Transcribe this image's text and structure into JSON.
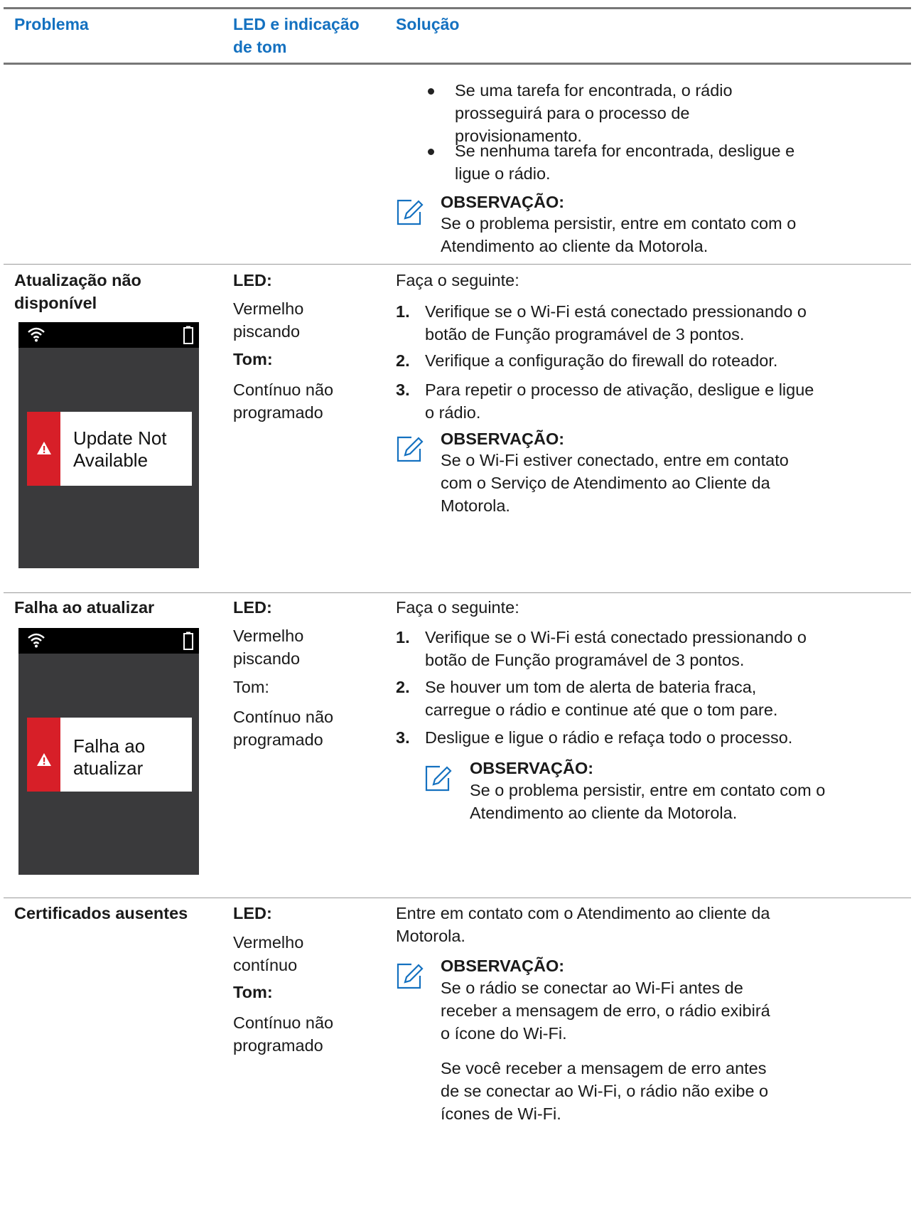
{
  "header": {
    "col_problem": "Problema",
    "col_led": "LED e indicação de tom",
    "col_solution": "Solução"
  },
  "continued_row": {
    "bullets": [
      "Se uma tarefa for encontrada, o rádio prosseguirá para o processo de provisionamento.",
      "Se nenhuma tarefa for encontrada, desligue e ligue o rádio."
    ],
    "note_title": "OBSERVAÇÃO:",
    "note_text": "Se o problema persistir, entre em contato com o Atendimento ao cliente da Motorola."
  },
  "rows": [
    {
      "problem": "Atualização não disponível",
      "led_label": "LED:",
      "led_value": "Vermelho piscando",
      "tone_label": "Tom:",
      "tone_value": "Contínuo não programado",
      "screen_text": "Update Not Available",
      "intro": "Faça o seguinte:",
      "steps": [
        {
          "n": "1.",
          "text": "Verifique se o Wi-Fi está conectado pressionando o botão de Função programável de 3 pontos."
        },
        {
          "n": "2.",
          "text": "Verifique a configuração do firewall do roteador."
        },
        {
          "n": "3.",
          "text": "Para repetir o processo de ativação, desligue e ligue o rádio."
        }
      ],
      "note_title": "OBSERVAÇÃO:",
      "note_text": "Se o Wi-Fi estiver conectado, entre em contato com o Serviço de Atendimento ao Cliente da Motorola."
    },
    {
      "problem": "Falha ao atualizar",
      "led_label": "LED:",
      "led_value": "Vermelho piscando",
      "tone_label": "Tom:",
      "tone_value": "Contínuo não programado",
      "screen_text": "Falha ao atualizar",
      "intro": "Faça o seguinte:",
      "steps": [
        {
          "n": "1.",
          "text": "Verifique se o Wi-Fi está conectado pressionando o botão de Função programável de 3 pontos."
        },
        {
          "n": "2.",
          "text": "Se houver um tom de alerta de bateria fraca, carregue o rádio e continue até que o tom pare."
        },
        {
          "n": "3.",
          "text": "Desligue e ligue o rádio e refaça todo o processo."
        }
      ],
      "note_title": "OBSERVAÇÃO:",
      "note_text": "Se o problema persistir, entre em contato com o Atendimento ao cliente da Motorola."
    },
    {
      "problem": "Certificados ausentes",
      "led_label": "LED:",
      "led_value": "Vermelho contínuo",
      "tone_label": "Tom:",
      "tone_value": "Contínuo não programado",
      "intro": "Entre em contato com o Atendimento ao cliente da Motorola.",
      "note_title": "OBSERVAÇÃO:",
      "note_text": "Se o rádio se conectar ao Wi-Fi antes de receber a mensagem de erro, o rádio exibirá o ícone do Wi-Fi.",
      "note_text_2": "Se você receber a mensagem de erro antes de se conectar ao Wi-Fi, o rádio não exibe o ícones de Wi-Fi."
    }
  ]
}
